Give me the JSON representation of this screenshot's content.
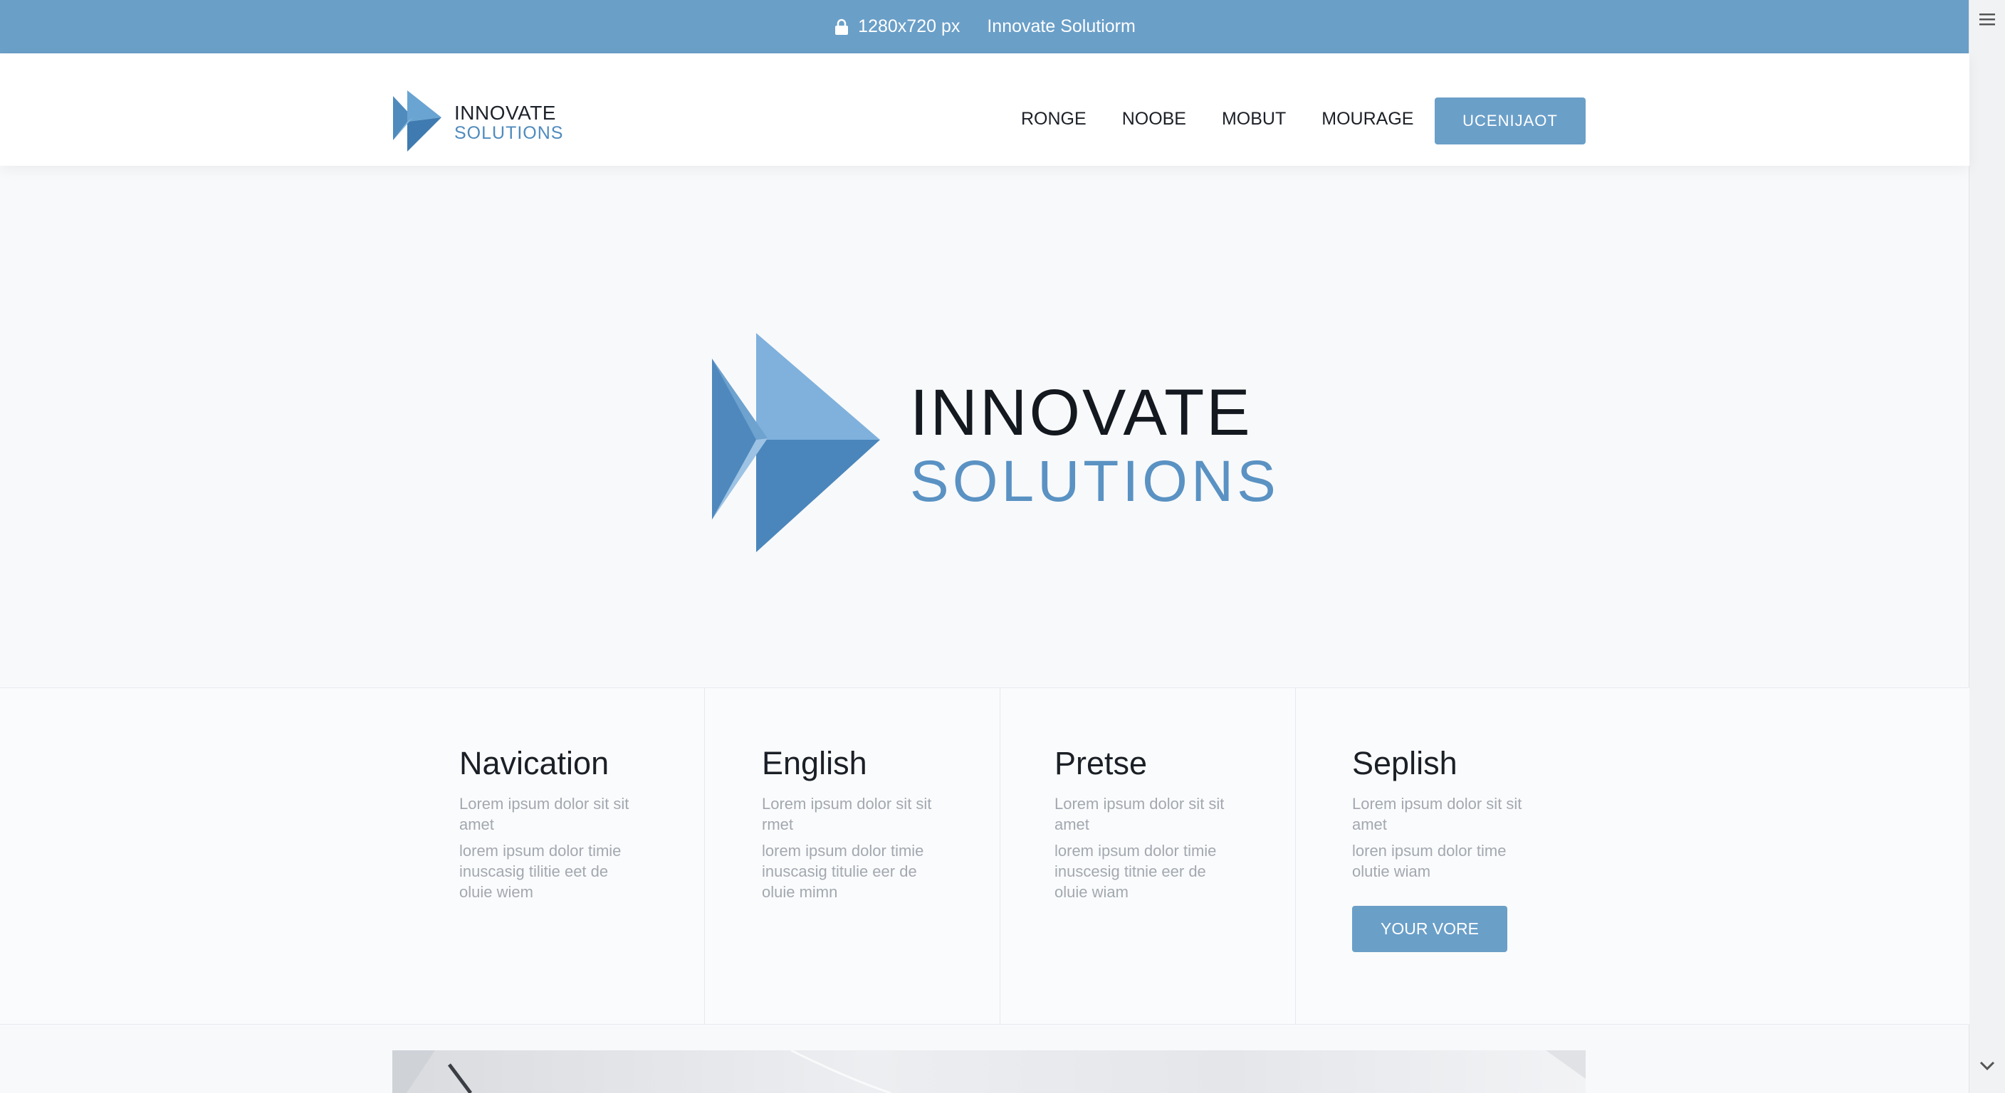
{
  "browser": {
    "size_label": "1280x720 px",
    "site_title": "Innovate Solutiorm"
  },
  "header": {
    "logo_line1": "INNOVATE",
    "logo_line2": "SOLUTIONS",
    "nav": [
      "RONGE",
      "NOOBE",
      "MOBUT",
      "MOURAGE"
    ],
    "cta_label": "UCENIJAOT"
  },
  "hero": {
    "title_line1": "INNOVATE",
    "title_line2": "SOLUTIONS"
  },
  "features": [
    {
      "title": "Navication",
      "text1": "Lorem ipsum dolor sit sit amet",
      "text2": "lorem ipsum dolor timie inuscasig tilitie eet de oluie wiem"
    },
    {
      "title": "English",
      "text1": "Lorem ipsum dolor sit sit rmet",
      "text2": "lorem ipsum dolor timie inuscasig titulie eer de oluie mimn"
    },
    {
      "title": "Pretse",
      "text1": "Lorem ipsum dolor sit sit amet",
      "text2": "lorem ipsum dolor timie inuscesig titnie eer de oluie wiam"
    },
    {
      "title": "Seplish",
      "text1": "Lorem ipsum dolor sit sit amet",
      "text2": "loren ipsum dolor time olutie wiam",
      "button_label": "YOUR VORE"
    }
  ],
  "colors": {
    "accent": "#6a9fc8",
    "brand_dark": "#14181f",
    "brand_blue": "#5a92c3"
  },
  "icons": [
    "lock-icon",
    "hamburger-menu-icon",
    "chevron-down-icon"
  ]
}
